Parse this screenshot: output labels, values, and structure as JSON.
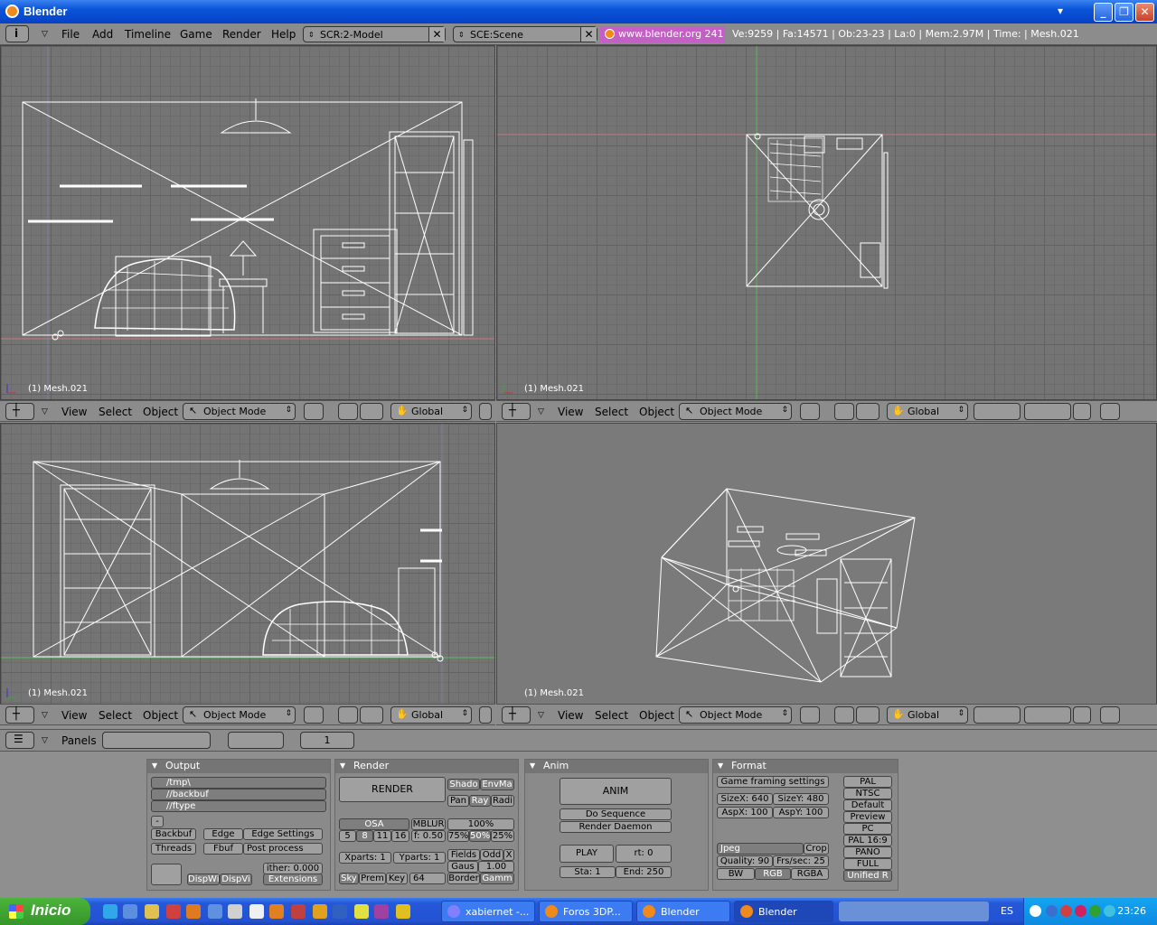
{
  "window": {
    "title": "Blender"
  },
  "menu": [
    "File",
    "Add",
    "Timeline",
    "Game",
    "Render",
    "Help"
  ],
  "screen_field": "SCR:2-Model",
  "scene_field": "SCE:Scene",
  "url": "www.blender.org 241",
  "stats": "Ve:9259 | Fa:14571 | Ob:23-23 | La:0 | Mem:2.97M | Time: | Mesh.021",
  "viewport_label": "(1) Mesh.021",
  "viewport_header": {
    "view": "View",
    "select": "Select",
    "object": "Object",
    "mode": "Object Mode",
    "orientation": "Global"
  },
  "buttons_header": {
    "panels": "Panels",
    "frame": "1"
  },
  "output_panel": {
    "title": "Output",
    "paths": [
      "/tmp\\",
      "//backbuf",
      "//ftype"
    ],
    "backbuf": "Backbuf",
    "edge": "Edge",
    "edge_settings": "Edge Settings",
    "threads": "Threads",
    "fbuf": "Fbuf",
    "post_process": "Post process",
    "dither": "ither: 0.000",
    "dispwi": "DispWi",
    "dispvi": "DispVi",
    "extensions": "Extensions"
  },
  "render_panel": {
    "title": "Render",
    "render": "RENDER",
    "shado": "Shado",
    "envma": "EnvMa",
    "pan": "Pan",
    "ray": "Ray",
    "radi": "Radi",
    "osa": "OSA",
    "osa_values": [
      "5",
      "8",
      "11",
      "16"
    ],
    "mblur": "MBLUR",
    "f_val": "f: 0.50",
    "pct100": "100%",
    "pct75": "75%",
    "pct50": "50%",
    "pct25": "25%",
    "xparts": "Xparts: 1",
    "yparts": "Yparts: 1",
    "fields": "Fields",
    "odd": "Odd",
    "x": "X",
    "gaus": "Gaus",
    "gaus_val": "1.00",
    "sky": "Sky",
    "prem": "Prem",
    "key": "Key",
    "bits": "64",
    "border": "Border",
    "gamm": "Gamm"
  },
  "anim_panel": {
    "title": "Anim",
    "anim": "ANIM",
    "do_sequence": "Do Sequence",
    "render_daemon": "Render Daemon",
    "play": "PLAY",
    "rt": "rt: 0",
    "sta": "Sta: 1",
    "end": "End: 250"
  },
  "format_panel": {
    "title": "Format",
    "game_framing": "Game framing settings",
    "sizex": "SizeX: 640",
    "sizey": "SizeY: 480",
    "aspx": "AspX: 100",
    "aspy": "AspY: 100",
    "format": "Jpeg",
    "crop": "Crop",
    "quality": "Quality: 90",
    "fps": "Frs/sec: 25",
    "bw": "BW",
    "rgb": "RGB",
    "rgba": "RGBA",
    "presets": [
      "PAL",
      "NTSC",
      "Default",
      "Preview",
      "PC",
      "PAL 16:9",
      "PANO",
      "FULL",
      "Unified R"
    ]
  },
  "taskbar": {
    "start": "Inicio",
    "tasks": [
      "xabiernet -...",
      "Foros 3DP...",
      "Blender",
      "Blender"
    ],
    "lang": "ES",
    "clock": "23:26"
  }
}
